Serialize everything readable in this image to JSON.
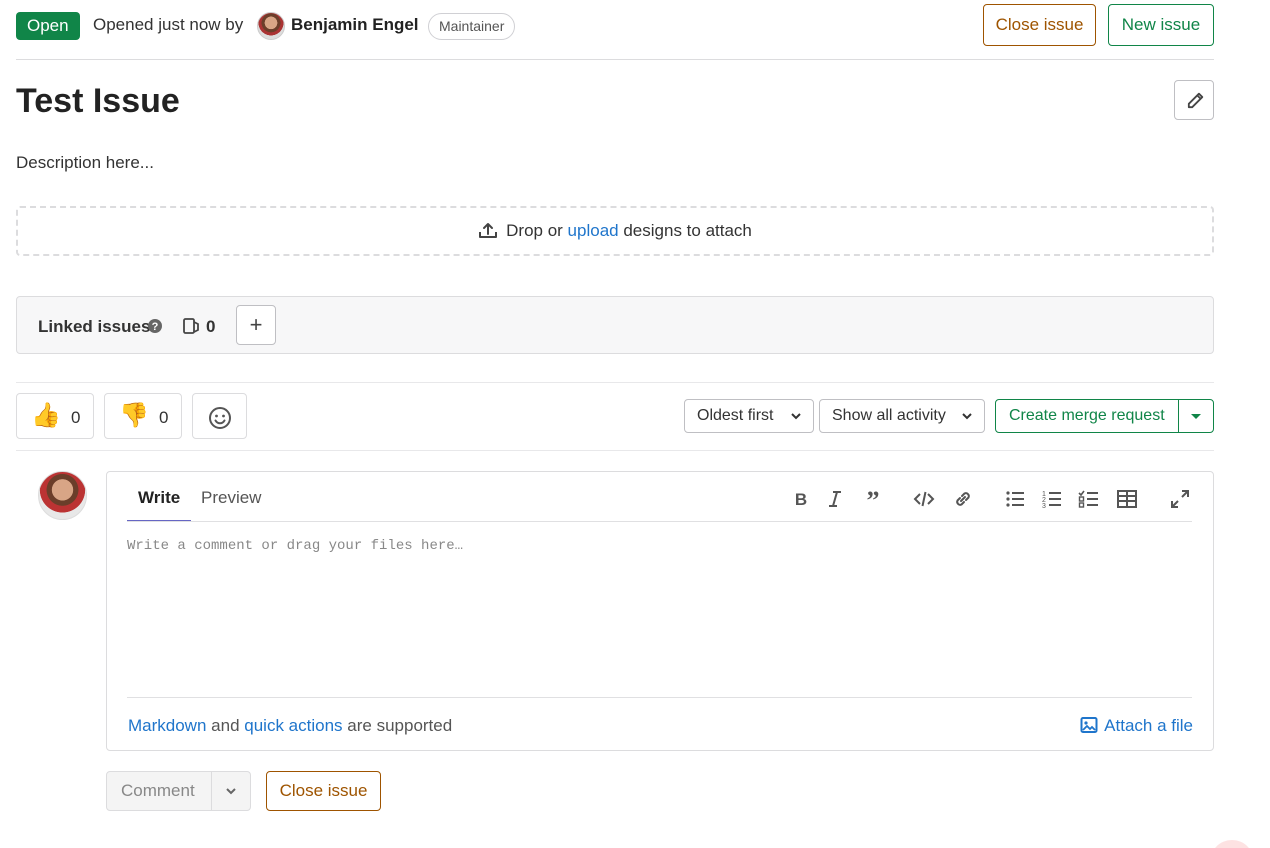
{
  "header": {
    "status": "Open",
    "opened_text": "Opened just now by",
    "author": "Benjamin Engel",
    "role": "Maintainer",
    "close_issue_label": "Close issue",
    "new_issue_label": "New issue"
  },
  "issue": {
    "title": "Test Issue",
    "description": "Description here..."
  },
  "dropzone": {
    "prefix": "Drop or",
    "link": "upload",
    "suffix": "designs to attach"
  },
  "linked_issues": {
    "label": "Linked issues",
    "count": "0",
    "add_label": "+"
  },
  "awards": {
    "thumbs_up_count": "0",
    "thumbs_down_count": "0"
  },
  "sort": {
    "order": "Oldest first",
    "filter": "Show all activity"
  },
  "merge_request": {
    "label": "Create merge request"
  },
  "editor": {
    "tab_write": "Write",
    "tab_preview": "Preview",
    "placeholder": "Write a comment or drag your files here…",
    "foot_link1": "Markdown",
    "foot_and": "and",
    "foot_link2": "quick actions",
    "foot_suffix": "are supported",
    "attach_label": "Attach a file"
  },
  "actions": {
    "comment_label": "Comment",
    "close_issue_label": "Close issue"
  },
  "colors": {
    "status_green": "#108548",
    "close_orange": "#9e5400",
    "link_blue": "#1f75cb",
    "tab_underline": "#6666c4"
  }
}
